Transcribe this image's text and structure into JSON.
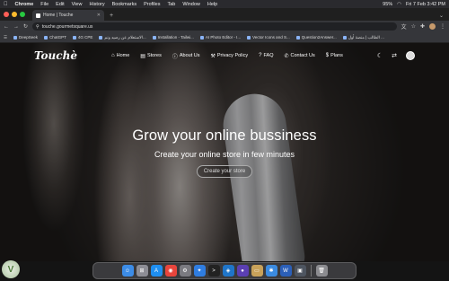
{
  "menubar": {
    "app": "Chrome",
    "items": [
      "File",
      "Edit",
      "View",
      "History",
      "Bookmarks",
      "Profiles",
      "Tab",
      "Window",
      "Help"
    ],
    "battery": "95%",
    "clock": "Fri 7 Feb  3:42 PM"
  },
  "browser": {
    "tab_title": "Home | Touche",
    "url": "touche.gourmetsquare.us",
    "bookmarks": [
      "DeepSeek",
      "ChatGPT",
      "4G CPE",
      "الاستعلام عن رصيد ونم...",
      "Installation - Tailwi...",
      "AI Photo Editor - I...",
      "Vector Icons and S...",
      "Question2Answer...",
      "الطالب | منصة أول ..."
    ]
  },
  "site": {
    "logo": "Touchè",
    "nav": [
      {
        "icon": "home-icon",
        "glyph": "⌂",
        "label": "Home"
      },
      {
        "icon": "store-icon",
        "glyph": "▤",
        "label": "Stores"
      },
      {
        "icon": "info-icon",
        "glyph": "ⓘ",
        "label": "About Us"
      },
      {
        "icon": "hammer-icon",
        "glyph": "⚒",
        "label": "Privacy Policy"
      },
      {
        "icon": "faq-icon",
        "glyph": "?",
        "label": "FAQ"
      },
      {
        "icon": "phone-icon",
        "glyph": "✆",
        "label": "Contact Us"
      },
      {
        "icon": "dollar-icon",
        "glyph": "$",
        "label": "Plans"
      }
    ],
    "theme_glyph": "☾",
    "lang_glyph": "⇄"
  },
  "hero": {
    "title": "Grow your online bussiness",
    "subtitle": "Create your online store in few minutes",
    "cta": "Create your store"
  },
  "dock": {
    "apps": [
      {
        "name": "finder-icon",
        "color": "#3c8ce7",
        "glyph": "☺"
      },
      {
        "name": "launchpad-icon",
        "color": "#8d8d95",
        "glyph": "⊞"
      },
      {
        "name": "app-store-icon",
        "color": "#1e8ef0",
        "glyph": "A"
      },
      {
        "name": "chrome-icon",
        "color": "#e8453c",
        "glyph": "◉"
      },
      {
        "name": "settings-icon",
        "color": "#7a7a80",
        "glyph": "⚙"
      },
      {
        "name": "safari-icon",
        "color": "#2f7de1",
        "glyph": "✦"
      },
      {
        "name": "terminal-icon",
        "color": "#222",
        "glyph": ">"
      },
      {
        "name": "vscode-icon",
        "color": "#1f75c9",
        "glyph": "◈"
      },
      {
        "name": "github-icon",
        "color": "#5b3fb3",
        "glyph": "●"
      },
      {
        "name": "preview-icon",
        "color": "#c8a25a",
        "glyph": "▭"
      },
      {
        "name": "files-icon",
        "color": "#3b8be0",
        "glyph": "✱"
      },
      {
        "name": "word-icon",
        "color": "#2b5fb8",
        "glyph": "W"
      },
      {
        "name": "window-icon",
        "color": "#4e5560",
        "glyph": "▣"
      },
      {
        "name": "trash-icon",
        "color": "#8c8c90",
        "glyph": "🗑"
      }
    ]
  }
}
